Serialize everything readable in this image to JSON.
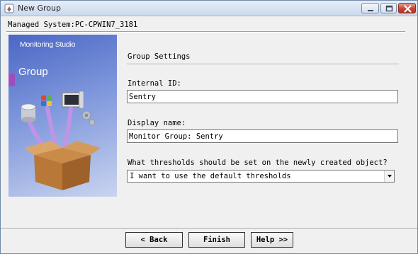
{
  "window": {
    "title": "New Group",
    "icon": "wizard-icon",
    "controls": [
      "minimize-icon",
      "maximize-icon",
      "close-icon"
    ]
  },
  "managed_system": "Managed System:PC-CPWIN7_3181",
  "banner": {
    "brand": "Monitoring Studio",
    "title": "Group"
  },
  "form": {
    "section_title": "Group Settings",
    "internal_id": {
      "label": "Internal ID:",
      "value": "Sentry"
    },
    "display_name": {
      "label": "Display name:",
      "value": "Monitor Group: Sentry"
    },
    "thresholds": {
      "label": "What thresholds should be set on the newly created object?",
      "selected": "I want to use the default thresholds"
    }
  },
  "buttons": {
    "back": "< Back",
    "finish": "Finish",
    "help": "Help >>"
  }
}
